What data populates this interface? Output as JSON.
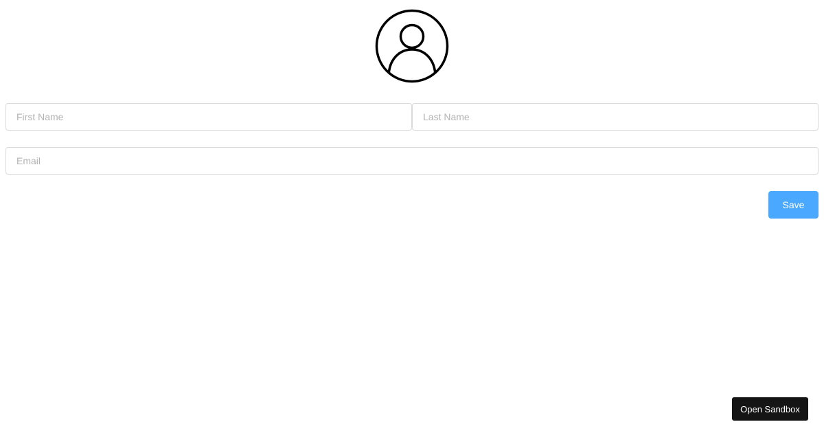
{
  "profile": {
    "avatar_icon": "user-circle-icon"
  },
  "form": {
    "first_name": {
      "value": "",
      "placeholder": "First Name"
    },
    "last_name": {
      "value": "",
      "placeholder": "Last Name"
    },
    "email": {
      "value": "",
      "placeholder": "Email"
    },
    "save_label": "Save"
  },
  "footer": {
    "sandbox_label": "Open Sandbox"
  },
  "colors": {
    "save_button_bg": "#4aa8ff",
    "sandbox_button_bg": "#151515",
    "icon_stroke": "#000000"
  }
}
